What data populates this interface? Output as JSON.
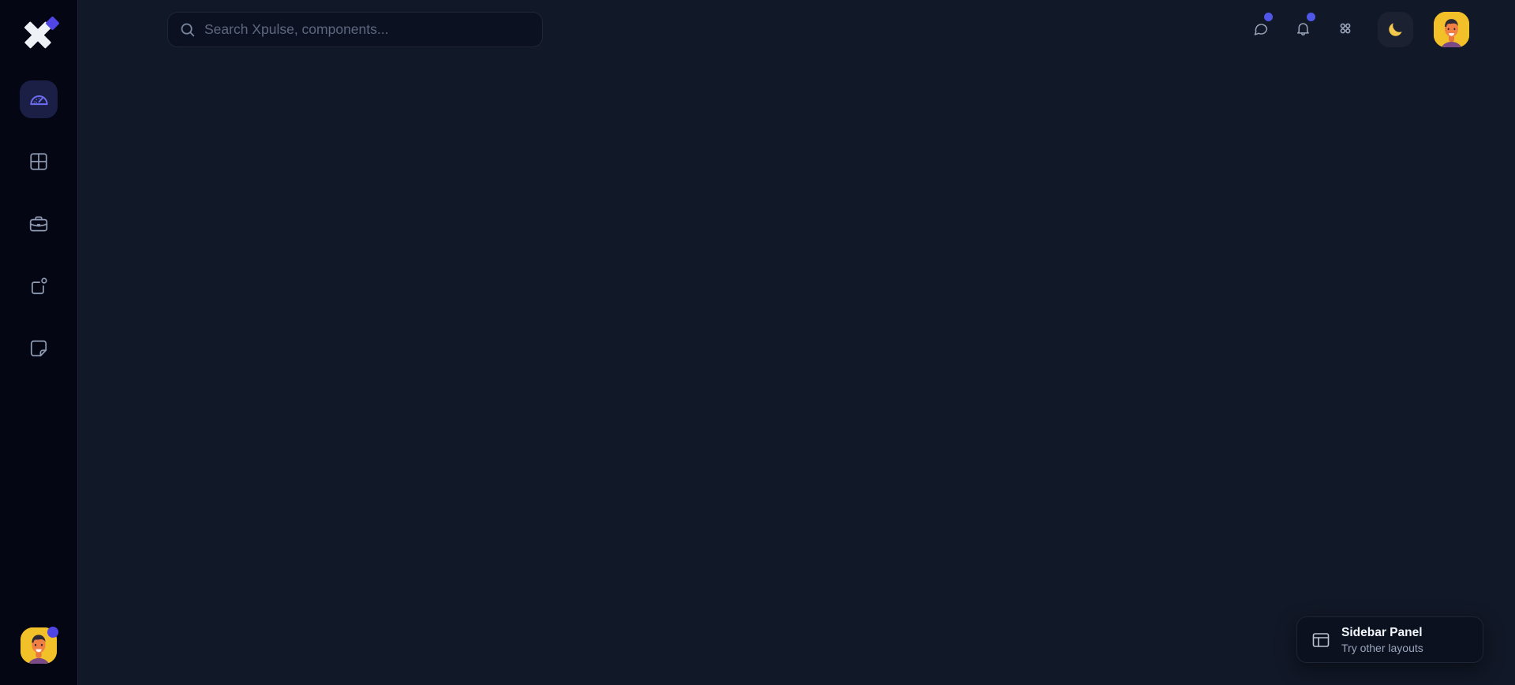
{
  "app": {
    "name": "Xpulse",
    "logo_icon": "xpulse-logo-icon",
    "theme": "dark",
    "colors": {
      "sidebar_bg": "#050614",
      "main_bg": "#111827",
      "accent": "#4f46e5",
      "active_nav_bg": "#1c1f45",
      "active_nav_fg": "#6f6ef0",
      "panel_bg": "#0b111f",
      "border": "#1e2639",
      "text_primary": "#f3f6fb",
      "text_muted": "#9aa6bb",
      "badge": "#4f56e8",
      "moon_yellow": "#f2c94c",
      "avatar_bg": "#f2c029"
    }
  },
  "sidebar": {
    "items": [
      {
        "icon": "dashboard-gauge-icon",
        "label": "Dashboard",
        "active": true
      },
      {
        "icon": "grid-layout-icon",
        "label": "Apps",
        "active": false
      },
      {
        "icon": "briefcase-icon",
        "label": "Projects",
        "active": false
      },
      {
        "icon": "square-dot-icon",
        "label": "Tasks",
        "active": false
      },
      {
        "icon": "sticker-note-icon",
        "label": "Notes",
        "active": false
      }
    ],
    "profile": {
      "avatar_name": "user-avatar",
      "status": "online",
      "status_color": "#4f46e5"
    }
  },
  "header": {
    "search": {
      "icon": "search-icon",
      "value": "",
      "placeholder": "Search Xpulse, components..."
    },
    "actions": [
      {
        "icon": "chat-bubble-icon",
        "label": "Messages",
        "badge": true
      },
      {
        "icon": "bell-icon",
        "label": "Notifications",
        "badge": true
      },
      {
        "icon": "apps-grid-icon",
        "label": "Apps",
        "badge": false
      }
    ],
    "theme_toggle": {
      "icon": "moon-icon",
      "label": "Toggle theme"
    },
    "avatar": {
      "icon": "user-avatar",
      "label": "Account"
    }
  },
  "toast": {
    "icon": "sidebar-panel-layout-icon",
    "title": "Sidebar Panel",
    "subtitle": "Try other layouts"
  }
}
